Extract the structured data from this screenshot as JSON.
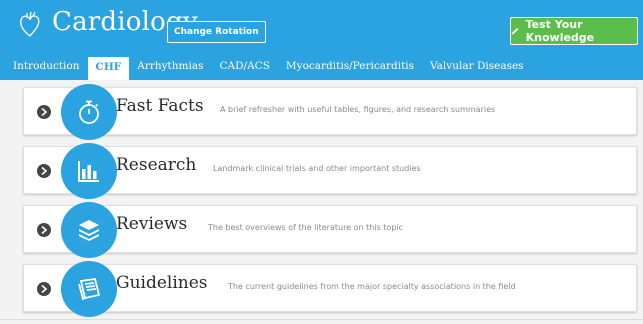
{
  "header": {
    "title": "Cardiology",
    "change_rotation_label": "Change Rotation",
    "test_button_label": "Test Your Knowledge"
  },
  "tabs": [
    {
      "label": "Introduction",
      "active": false
    },
    {
      "label": "CHF",
      "active": true
    },
    {
      "label": "Arrhythmias",
      "active": false
    },
    {
      "label": "CAD/ACS",
      "active": false
    },
    {
      "label": "Myocarditis/Pericarditis",
      "active": false
    },
    {
      "label": "Valvular Diseases",
      "active": false
    }
  ],
  "sections": [
    {
      "title": "Fast Facts",
      "description": "A brief refresher with useful tables, figures, and research summaries",
      "icon": "stopwatch-icon"
    },
    {
      "title": "Research",
      "description": "Landmark clinical trials and other important studies",
      "icon": "bar-chart-icon"
    },
    {
      "title": "Reviews",
      "description": "The best overviews of the literature on this topic",
      "icon": "layers-icon"
    },
    {
      "title": "Guidelines",
      "description": "The current guidelines from the major specialty associations in the field",
      "icon": "book-icon"
    }
  ],
  "colors": {
    "header_blue": "#2ba3e0",
    "test_button_green": "#5bbd4a",
    "expand_button_dark": "#454545"
  }
}
